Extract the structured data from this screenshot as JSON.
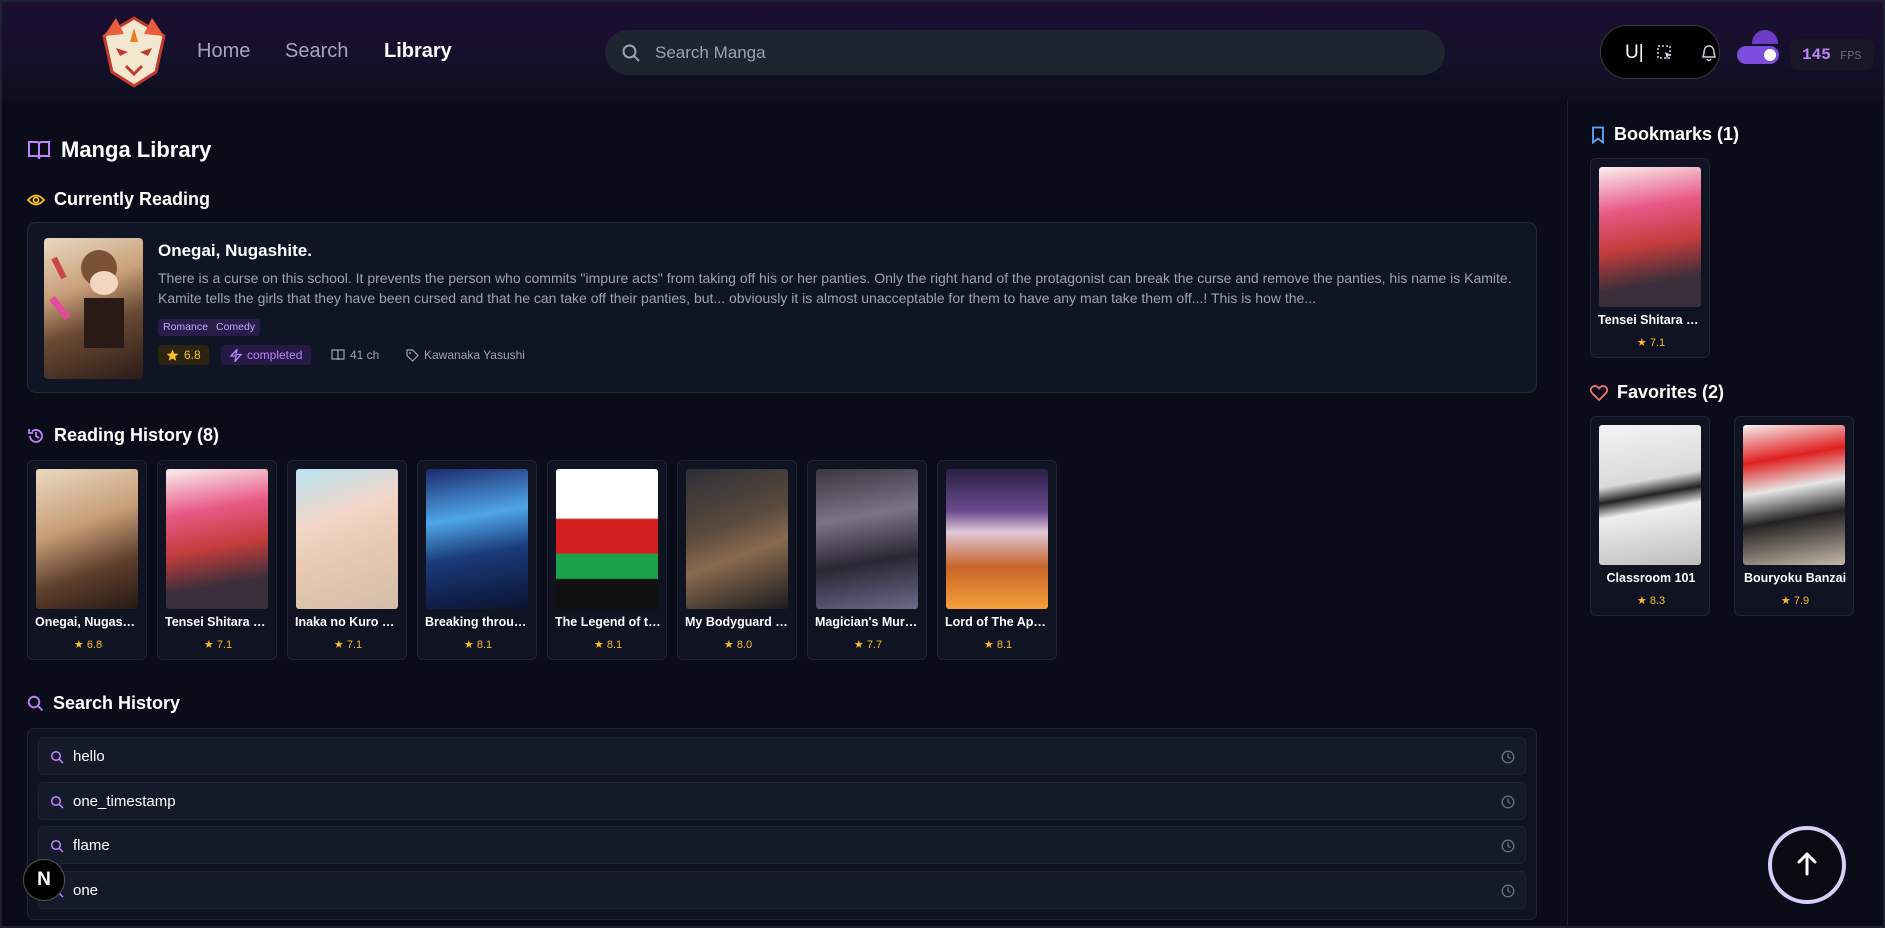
{
  "header": {
    "nav": {
      "home": "Home",
      "search": "Search",
      "library": "Library"
    },
    "search_placeholder": "Search Manga",
    "pill_text": "U|",
    "fps_value": "145",
    "fps_unit": "FPS"
  },
  "library": {
    "title": "Manga Library",
    "currently_reading": {
      "heading": "Currently Reading",
      "title": "Onegai, Nugashite.",
      "description": "There is a curse on this school. It prevents the person who commits \"impure acts\" from taking off his or her panties. Only the right hand of the protagonist can break the curse and remove the panties, his name is Kamite. Kamite tells the girls that they have been cursed and that he can take off their panties, but... obviously it is almost unacceptable for them to have any man take them off...! This is how the...",
      "tags": [
        "Romance",
        "Comedy"
      ],
      "rating": "6.8",
      "status": "completed",
      "chapters": "41 ch",
      "author": "Kawanaka Yasushi"
    },
    "reading_history": {
      "heading": "Reading History (8)",
      "items": [
        {
          "title": "Onegai, Nugashite.",
          "rating": "6.8"
        },
        {
          "title": "Tensei Shitara Ore ga Heroine de",
          "rating": "7.1"
        },
        {
          "title": "Inaka no Kuro Gal JK",
          "rating": "7.1"
        },
        {
          "title": "Breaking through the Clouds",
          "rating": "8.1"
        },
        {
          "title": "The Legend of the Link",
          "rating": "8.1"
        },
        {
          "title": "My Bodyguard is a Monster",
          "rating": "8.0"
        },
        {
          "title": "Magician's Murder Case",
          "rating": "7.7"
        },
        {
          "title": "Lord of The Apocalypse",
          "rating": "8.1"
        }
      ]
    },
    "search_history": {
      "heading": "Search History",
      "items": [
        "hello",
        "one_timestamp",
        "flame",
        "one"
      ]
    }
  },
  "sidebar": {
    "bookmarks": {
      "heading": "Bookmarks (1)",
      "items": [
        {
          "title": "Tensei Shitara Ore ga Heroine de",
          "rating": "7.1"
        }
      ]
    },
    "favorites": {
      "heading": "Favorites (2)",
      "items": [
        {
          "title": "Classroom 101",
          "rating": "8.3"
        },
        {
          "title": "Bouryoku Banzai",
          "rating": "7.9"
        }
      ]
    }
  },
  "floating": {
    "n_label": "N"
  },
  "colors": {
    "accent": "#c084fc",
    "star": "#fbbf24",
    "bookmark": "#60a5fa",
    "heart": "#f87171"
  }
}
